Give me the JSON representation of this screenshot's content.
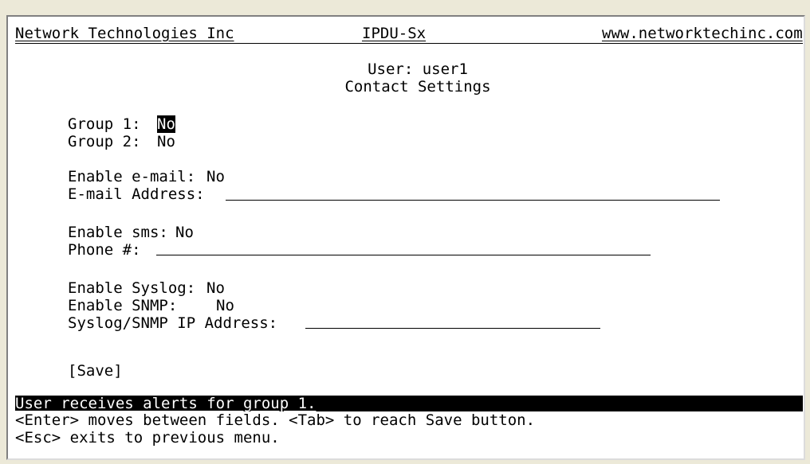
{
  "header": {
    "company": "Network Technologies Inc",
    "product": "IPDU-Sx",
    "website": "www.networktechinc.com"
  },
  "title": {
    "user_line": "User: user1",
    "subtitle": "Contact Settings"
  },
  "groups": {
    "group1_label": "Group 1:",
    "group1_value": "No",
    "group2_label": "Group 2:",
    "group2_value": "No"
  },
  "email": {
    "enable_label": "Enable e-mail:",
    "enable_value": "No",
    "address_label": "E-mail Address:",
    "address_value": ""
  },
  "sms": {
    "enable_label": "Enable sms:",
    "enable_value": "No",
    "phone_label": "Phone #:",
    "phone_value": ""
  },
  "syslog": {
    "syslog_label": "Enable Syslog:",
    "syslog_value": "No",
    "snmp_label": "Enable SNMP:",
    "snmp_value": "No",
    "ip_label": "Syslog/SNMP IP Address:",
    "ip_value": ""
  },
  "save_label": "[Save]",
  "status": {
    "message": "User receives alerts for group 1.",
    "help_line1": "<Enter> moves between fields. <Tab> to reach Save button.",
    "help_line2": "<Esc> exits to previous menu."
  }
}
